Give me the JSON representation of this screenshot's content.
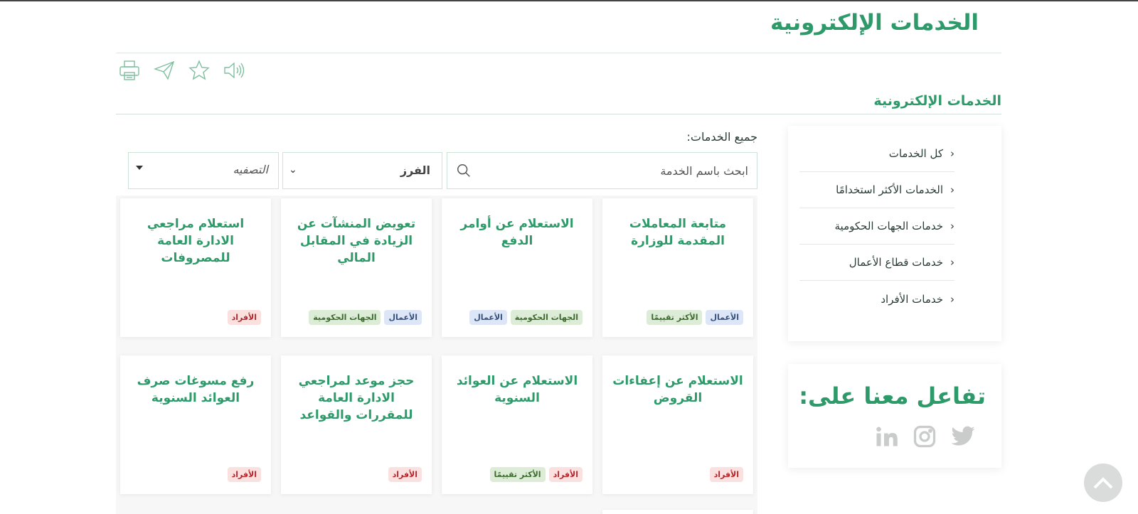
{
  "header": {
    "title": "الخدمات الإلكترونية"
  },
  "tools": [
    "printer-icon",
    "share-icon",
    "star-icon",
    "speaker-icon"
  ],
  "section": {
    "title": "الخدمات الإلكترونية"
  },
  "sidebar": {
    "items": [
      {
        "label": "كل الخدمات"
      },
      {
        "label": "الخدمات الأكثر استخدامًا"
      },
      {
        "label": "خدمات الجهات الحكومية"
      },
      {
        "label": "خدمات قطاع الأعمال"
      },
      {
        "label": "خدمات الأفراد"
      }
    ]
  },
  "social": {
    "title": "تفاعل معنا على:",
    "icons": [
      "twitter-icon",
      "instagram-icon",
      "linkedin-icon"
    ]
  },
  "main": {
    "all_services_label": "جميع الخدمات:",
    "search": {
      "placeholder": "ابحث باسم الخدمة"
    },
    "sort": {
      "value": "الفرز"
    },
    "filter": {
      "value": "التصفيه"
    }
  },
  "cards": [
    {
      "title": "متابعة المعاملات المقدمة للوزارة",
      "tags": [
        {
          "label": "الأعمال",
          "kind": "business"
        },
        {
          "label": "الأكثر تقييمًا",
          "kind": "popular"
        }
      ]
    },
    {
      "title": "الاستعلام عن أوامر الدفع",
      "tags": [
        {
          "label": "الجهات الحكومية",
          "kind": "gov"
        },
        {
          "label": "الأعمال",
          "kind": "business"
        }
      ]
    },
    {
      "title": "تعويض المنشآت عن الزيادة في المقابل المالي",
      "tags": [
        {
          "label": "الأعمال",
          "kind": "business"
        },
        {
          "label": "الجهات الحكومية",
          "kind": "gov"
        }
      ]
    },
    {
      "title": "استعلام مراجعي الادارة العامة للمصروفات",
      "tags": [
        {
          "label": "الأفراد",
          "kind": "individuals"
        }
      ]
    },
    {
      "title": "الاستعلام عن إعفاءات القروض",
      "tags": [
        {
          "label": "الأفراد",
          "kind": "individuals"
        }
      ]
    },
    {
      "title": "الاستعلام عن العوائد السنوية",
      "tags": [
        {
          "label": "الأفراد",
          "kind": "individuals"
        },
        {
          "label": "الأكثر تقييمًا",
          "kind": "popular"
        }
      ]
    },
    {
      "title": "حجز موعد لمراجعي الادارة العامة للمقررات والقواعد",
      "tags": [
        {
          "label": "الأفراد",
          "kind": "individuals"
        }
      ]
    },
    {
      "title": "رفع مسوغات صرف العوائد السنوية",
      "tags": [
        {
          "label": "الأفراد",
          "kind": "individuals"
        }
      ]
    }
  ],
  "colors": {
    "brand_green": "#2e9a6a",
    "tag_business": "#dde6f6",
    "tag_popular": "#dcecd6",
    "tag_individuals": "#fbe0e0"
  }
}
